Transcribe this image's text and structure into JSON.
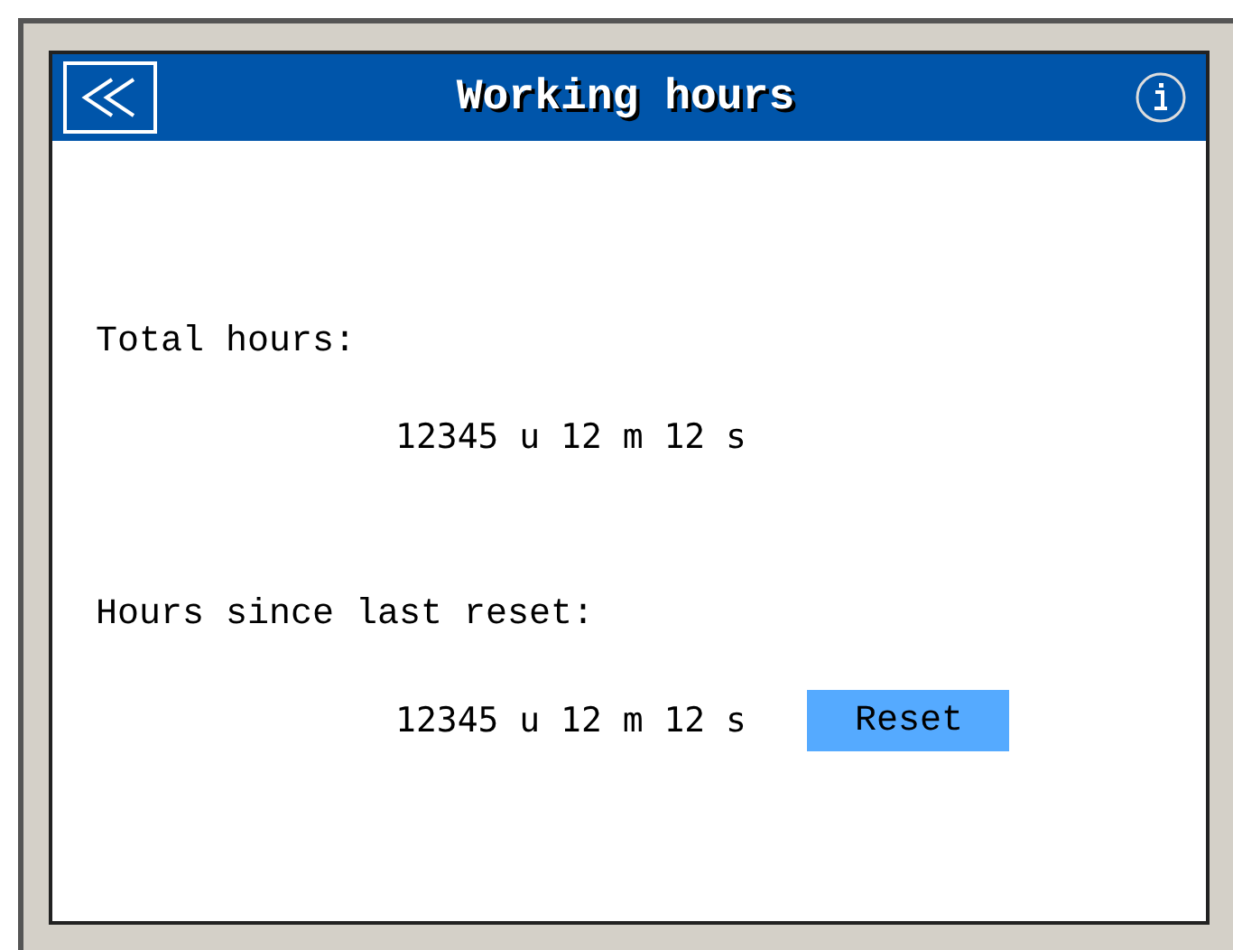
{
  "header": {
    "title": "Working hours"
  },
  "sections": [
    {
      "label": "Total hours:",
      "value": "12345 u 12 m 12 s"
    },
    {
      "label": "Hours since last reset:",
      "value": "12345 u 12 m 12 s",
      "button": "Reset"
    }
  ]
}
